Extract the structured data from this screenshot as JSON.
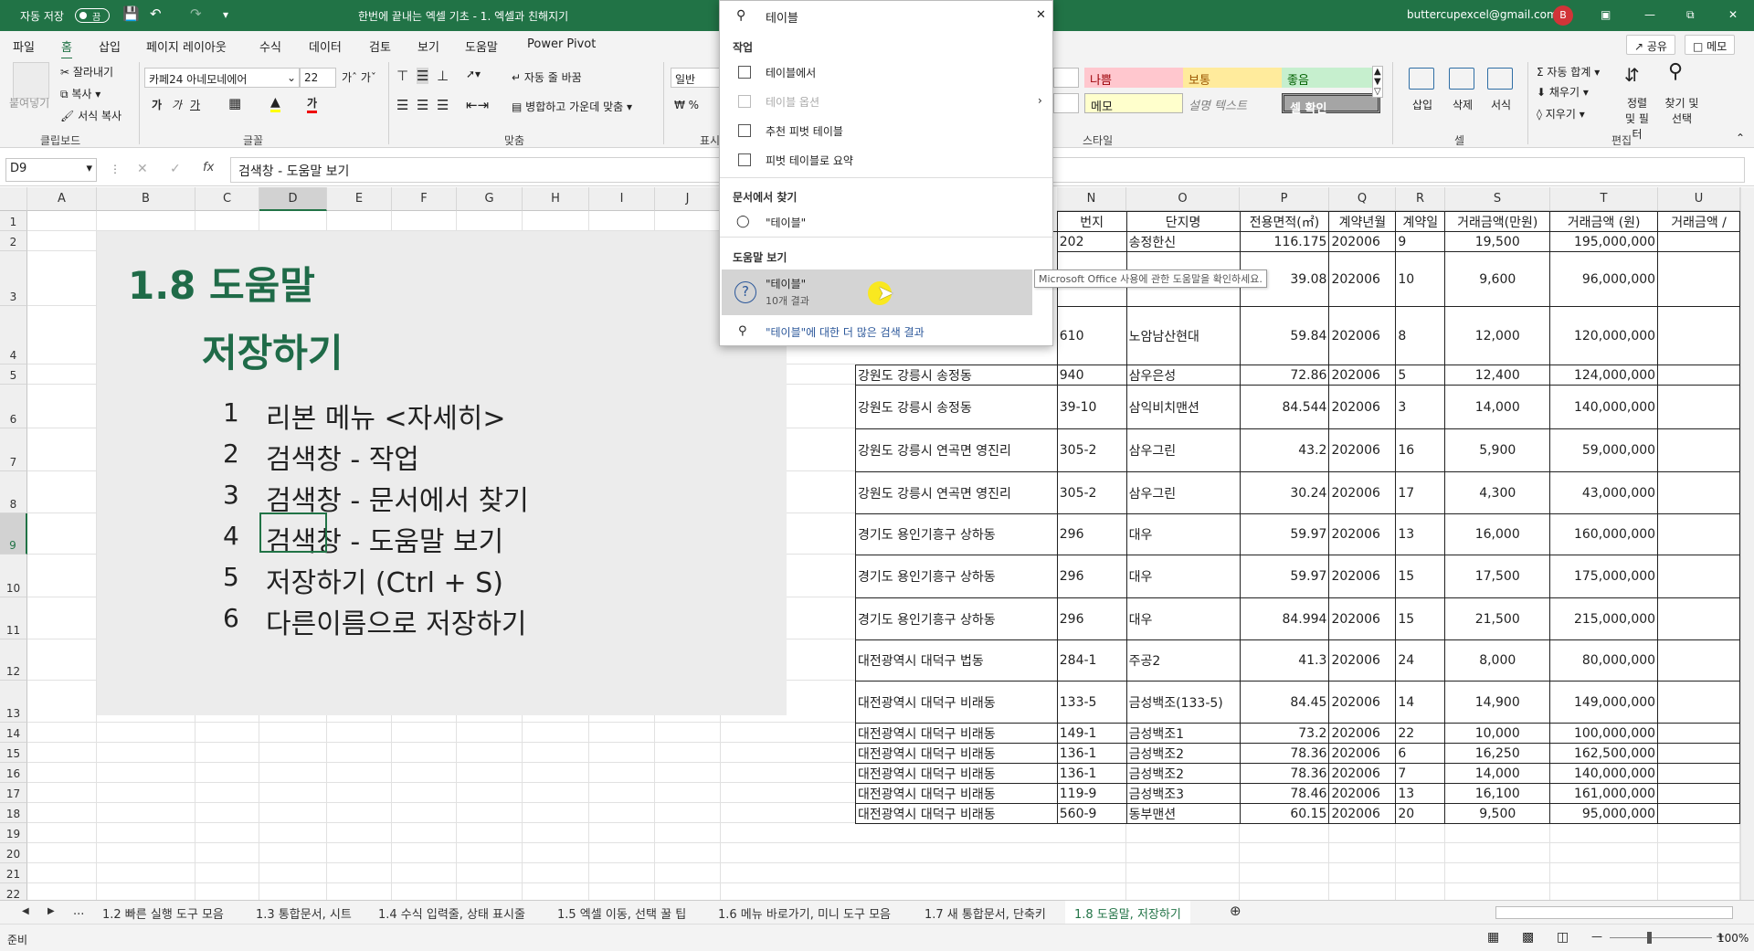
{
  "titlebar": {
    "autosave_label": "자동 저장",
    "autosave_state": "끔",
    "document_title": "한번에 끝내는 엑셀 기초 - 1. 엑셀과 친해지기",
    "account": "buttercupexcel@gmail.com",
    "avatar_initial": "B"
  },
  "menu": {
    "items": [
      "파일",
      "홈",
      "삽입",
      "페이지 레이아웃",
      "수식",
      "데이터",
      "검토",
      "보기",
      "도움말",
      "Power Pivot"
    ],
    "active": "홈",
    "share": "공유",
    "memo": "메모"
  },
  "ribbon": {
    "clipboard": {
      "paste": "붙여넣기",
      "cut": "잘라내기",
      "copy": "복사",
      "format_painter": "서식 복사",
      "group": "클립보드"
    },
    "font": {
      "name": "카페24 아네모네에어",
      "size": "22",
      "group": "글꼴",
      "bold": "가",
      "italic": "가",
      "underline": "가"
    },
    "align": {
      "wrap": "자동 줄 바꿈",
      "merge": "병합하고 가운데 맞춤",
      "group": "맞춤"
    },
    "number": {
      "format": "일반",
      "group": "표시"
    },
    "styles": {
      "bad": "나쁨",
      "neutral": "보통",
      "good": "좋음",
      "memo": "메모",
      "explain": "설명 텍스트",
      "check": "셀 확인",
      "group": "스타일"
    },
    "cells": {
      "insert": "삽입",
      "delete": "삭제",
      "format": "서식",
      "group": "셀"
    },
    "editing": {
      "autosum": "자동 합계",
      "fill": "채우기",
      "clear": "지우기",
      "sort": "정렬 및 필터",
      "find": "찾기 및 선택",
      "group": "편집"
    }
  },
  "formula_bar": {
    "name_box": "D9",
    "fx": "fx",
    "content": "검색창 - 도움말 보기"
  },
  "columns": [
    "A",
    "B",
    "C",
    "D",
    "E",
    "F",
    "G",
    "H",
    "I",
    "J",
    "N",
    "O",
    "P",
    "Q",
    "R",
    "S",
    "T",
    "U"
  ],
  "rows": [
    "1",
    "2",
    "3",
    "4",
    "5",
    "6",
    "7",
    "8",
    "9",
    "10",
    "11",
    "12",
    "13",
    "14",
    "15",
    "16",
    "17",
    "18",
    "19",
    "20",
    "21",
    "22"
  ],
  "panel": {
    "title_line1": "1.8 도움말",
    "title_line2": "저장하기",
    "items": [
      {
        "n": "1",
        "text": "리본 메뉴 <자세히>"
      },
      {
        "n": "2",
        "text": "검색창 - 작업"
      },
      {
        "n": "3",
        "text": "검색창 - 문서에서 찾기"
      },
      {
        "n": "4",
        "text": "검색창 - 도움말 보기"
      },
      {
        "n": "5",
        "text": "저장하기 (Ctrl + S)"
      },
      {
        "n": "6",
        "text": "다른이름으로 저장하기"
      }
    ]
  },
  "table": {
    "headers": [
      "",
      "번지",
      "단지명",
      "전용면적(㎡)",
      "계약년월",
      "계약일",
      "거래금액(만원)",
      "거래금액 (원)",
      "거래금액 / "
    ],
    "rows": [
      [
        "",
        "202",
        "송정한신",
        "116.175",
        "202006",
        "9",
        "19,500",
        "195,000,000",
        ""
      ],
      [
        "",
        "",
        "",
        "39.08",
        "202006",
        "10",
        "9,600",
        "96,000,000",
        ""
      ],
      [
        "",
        "610",
        "노암남산현대",
        "59.84",
        "202006",
        "8",
        "12,000",
        "120,000,000",
        ""
      ],
      [
        "강원도 강릉시 송정동",
        "940",
        "삼우은성",
        "72.86",
        "202006",
        "5",
        "12,400",
        "124,000,000",
        ""
      ],
      [
        "강원도 강릉시 송정동",
        "39-10",
        "삼익비치맨션",
        "84.544",
        "202006",
        "3",
        "14,000",
        "140,000,000",
        ""
      ],
      [
        "강원도 강릉시 연곡면 영진리",
        "305-2",
        "삼우그린",
        "43.2",
        "202006",
        "16",
        "5,900",
        "59,000,000",
        ""
      ],
      [
        "강원도 강릉시 연곡면 영진리",
        "305-2",
        "삼우그린",
        "30.24",
        "202006",
        "17",
        "4,300",
        "43,000,000",
        ""
      ],
      [
        "경기도 용인기흥구 상하동",
        "296",
        "대우",
        "59.97",
        "202006",
        "13",
        "16,000",
        "160,000,000",
        ""
      ],
      [
        "경기도 용인기흥구 상하동",
        "296",
        "대우",
        "59.97",
        "202006",
        "15",
        "17,500",
        "175,000,000",
        ""
      ],
      [
        "경기도 용인기흥구 상하동",
        "296",
        "대우",
        "84.994",
        "202006",
        "15",
        "21,500",
        "215,000,000",
        ""
      ],
      [
        "대전광역시 대덕구 법동",
        "284-1",
        "주공2",
        "41.3",
        "202006",
        "24",
        "8,000",
        "80,000,000",
        ""
      ],
      [
        "대전광역시 대덕구 비래동",
        "133-5",
        "금성백조(133-5)",
        "84.45",
        "202006",
        "14",
        "14,900",
        "149,000,000",
        ""
      ],
      [
        "대전광역시 대덕구 비래동",
        "149-1",
        "금성백조1",
        "73.2",
        "202006",
        "22",
        "10,000",
        "100,000,000",
        ""
      ],
      [
        "대전광역시 대덕구 비래동",
        "136-1",
        "금성백조2",
        "78.36",
        "202006",
        "6",
        "16,250",
        "162,500,000",
        ""
      ],
      [
        "대전광역시 대덕구 비래동",
        "136-1",
        "금성백조2",
        "78.36",
        "202006",
        "7",
        "14,000",
        "140,000,000",
        ""
      ],
      [
        "대전광역시 대덕구 비래동",
        "119-9",
        "금성백조3",
        "78.46",
        "202006",
        "13",
        "16,100",
        "161,000,000",
        ""
      ],
      [
        "대전광역시 대덕구 비래동",
        "560-9",
        "동부맨션",
        "60.15",
        "202006",
        "20",
        "9,500",
        "95,000,000",
        ""
      ]
    ]
  },
  "search": {
    "query": "테이블",
    "sec_actions": "작업",
    "act1": "테이블에서",
    "act2": "테이블 옵션",
    "act3": "추천 피벗 테이블",
    "act4": "피벗 테이블로 요약",
    "sec_docs": "문서에서 찾기",
    "doc1": "\"테이블\"",
    "sec_help": "도움말 보기",
    "help1": "\"테이블\"",
    "help1_sub": "10개 결과",
    "more": "\"테이블\"에 대한 더 많은 검색 결과",
    "tooltip": "Microsoft Office 사용에 관한 도움말을 확인하세요."
  },
  "sheet_tabs": {
    "ellipsis": "...",
    "tabs": [
      "1.2 빠른 실행 도구 모음",
      "1.3 통합문서, 시트",
      "1.4 수식 입력줄, 상태 표시줄",
      "1.5 엑셀 이동, 선택 꿀 팁",
      "1.6 메뉴 바로가기, 미니 도구 모음",
      "1.7 새 통합문서, 단축키",
      "1.8 도움말, 저장하기"
    ],
    "active_index": 6
  },
  "status": {
    "ready": "준비",
    "zoom": "100%"
  },
  "colors": {
    "excel_green": "#217346",
    "title_green": "#1f6b48"
  }
}
